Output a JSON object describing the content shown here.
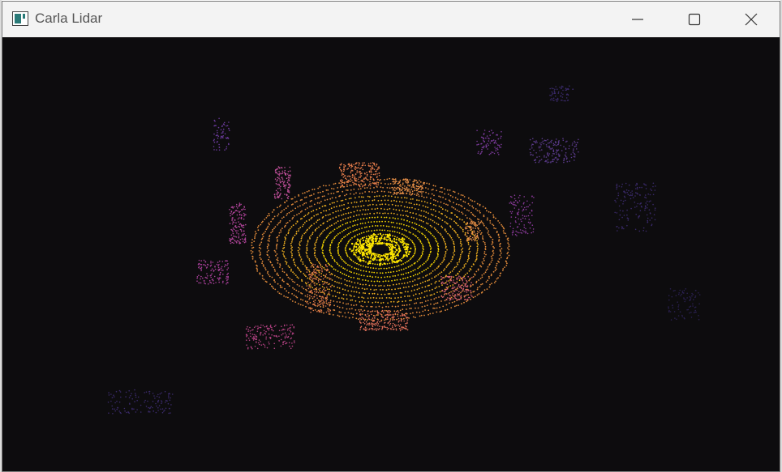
{
  "window": {
    "title": "Carla Lidar",
    "icon": "app-window-icon",
    "controls": [
      "minimize-icon",
      "maximize-icon",
      "close-icon"
    ]
  },
  "colors": {
    "titlebar_bg": "#f3f3f3",
    "canvas_bg": "#0d0c0e",
    "near_points": "#f5d400",
    "mid_points": "#e8904a",
    "far_points": "#b0449a",
    "farthest_points": "#3a2a6a"
  }
}
